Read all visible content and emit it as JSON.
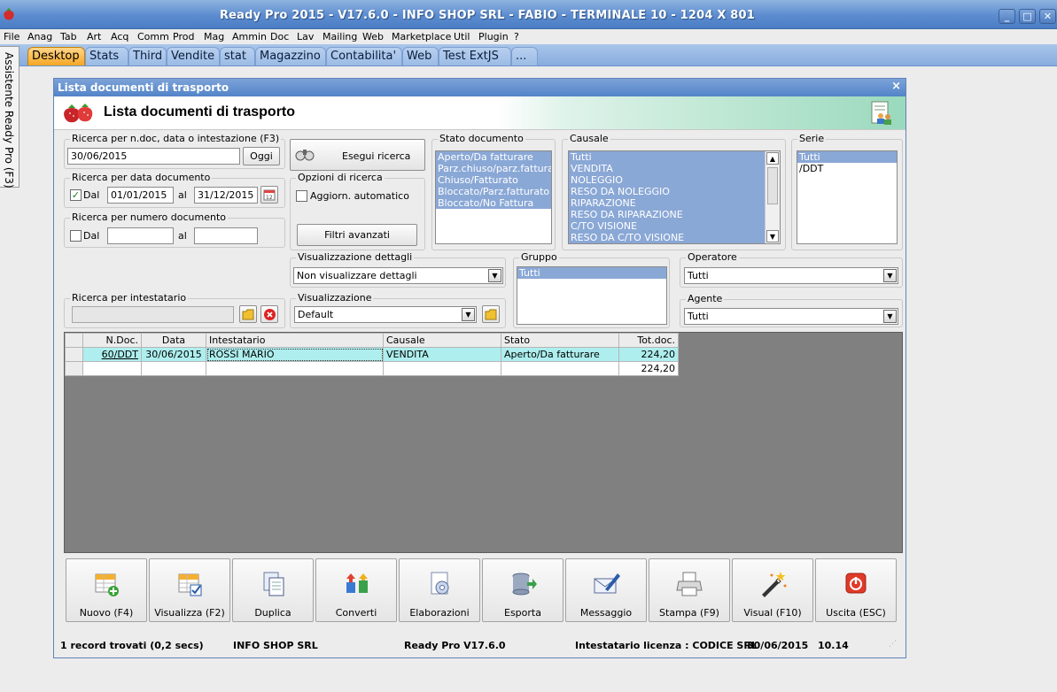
{
  "app": {
    "title": "Ready Pro 2015 - V17.6.0 - INFO SHOP SRL - FABIO - TERMINALE 10 - 1204 X 801",
    "minimize": "_",
    "maximize": "□",
    "close": "✕"
  },
  "menu": [
    "File",
    "Anag",
    "Tab",
    "Art",
    "Acq",
    "Comm",
    "Prod",
    "Mag",
    "Ammin",
    "Doc",
    "Lav",
    "Mailing",
    "Web",
    "Marketplace",
    "Util",
    "Plugin",
    "?"
  ],
  "tabs": [
    "Desktop",
    "Stats",
    "Third",
    "Vendite",
    "stat",
    "Magazzino",
    "Contabilita'",
    "Web",
    "Test ExtJS",
    "..."
  ],
  "side_tab": "Assistente Ready Pro (F3)",
  "window": {
    "title": "Lista documenti di trasporto",
    "header": "Lista documenti di trasporto",
    "close": "×"
  },
  "search": {
    "label": "Ricerca per n.doc, data o intestazione (F3)",
    "value": "30/06/2015",
    "today_button": "Oggi",
    "run_button": "Esegui ricerca"
  },
  "date_search": {
    "label": "Ricerca per data documento",
    "dal": "Dal",
    "al": "al",
    "from": "01/01/2015",
    "to": "31/12/2015",
    "checked": "✓"
  },
  "number_search": {
    "label": "Ricerca per numero documento",
    "dal": "Dal",
    "al": "al",
    "from": "",
    "to": ""
  },
  "options": {
    "label": "Opzioni di ricerca",
    "auto_update": "Aggiorn. automatico",
    "advanced_filters": "Filtri avanzati"
  },
  "stato": {
    "label": "Stato documento",
    "items": [
      "Aperto/Da fatturare",
      "Parz.chiuso/parz.fatturato",
      "Chiuso/Fatturato",
      "Bloccato/Parz.fatturato",
      "Bloccato/No Fattura"
    ]
  },
  "causale": {
    "label": "Causale",
    "items": [
      "Tutti",
      "VENDITA",
      "NOLEGGIO",
      "RESO DA NOLEGGIO",
      "RIPARAZIONE",
      "RESO DA RIPARAZIONE",
      "C/TO VISIONE",
      "RESO DA C/TO VISIONE"
    ]
  },
  "serie": {
    "label": "Serie",
    "items": [
      "Tutti",
      "/DDT"
    ]
  },
  "dettagli": {
    "label": "Visualizzazione dettagli",
    "value": "Non visualizzare dettagli"
  },
  "gruppo": {
    "label": "Gruppo",
    "items": [
      "Tutti"
    ]
  },
  "operatore": {
    "label": "Operatore",
    "value": "Tutti"
  },
  "intestatario": {
    "label": "Ricerca per intestatario",
    "value": ""
  },
  "visualizzazione": {
    "label": "Visualizzazione",
    "value": "Default"
  },
  "agente": {
    "label": "Agente",
    "value": "Tutti"
  },
  "grid": {
    "columns": [
      "N.Doc.",
      "Data",
      "Intestatario",
      "Causale",
      "Stato",
      "Tot.doc."
    ],
    "rows": [
      {
        "ndoc": "60/DDT",
        "data": "30/06/2015",
        "intestatario": "ROSSI MARIO",
        "causale": "VENDITA",
        "stato": "Aperto/Da fatturare",
        "tot": "224,20"
      }
    ],
    "total": "224,20"
  },
  "toolbar": [
    {
      "label": "Nuovo (F4)",
      "icon": "new-document-icon"
    },
    {
      "label": "Visualizza (F2)",
      "icon": "view-document-icon"
    },
    {
      "label": "Duplica",
      "icon": "duplicate-icon"
    },
    {
      "label": "Converti",
      "icon": "convert-icon"
    },
    {
      "label": "Elaborazioni",
      "icon": "processing-icon"
    },
    {
      "label": "Esporta",
      "icon": "export-icon"
    },
    {
      "label": "Messaggio",
      "icon": "message-icon"
    },
    {
      "label": "Stampa (F9)",
      "icon": "printer-icon"
    },
    {
      "label": "Visual (F10)",
      "icon": "magic-wand-icon"
    },
    {
      "label": "Uscita (ESC)",
      "icon": "exit-icon"
    }
  ],
  "status": {
    "records": "1 record trovati (0,2 secs)",
    "company": "INFO SHOP SRL",
    "version": "Ready Pro V17.6.0",
    "license": "Intestatario licenza : CODICE SRL",
    "date": "30/06/2015",
    "time": "10.14"
  },
  "colors": {
    "accent": "#5384c9",
    "active_tab": "#f5a623",
    "selection": "#8aa8d6",
    "row_highlight": "#aeeeee"
  }
}
